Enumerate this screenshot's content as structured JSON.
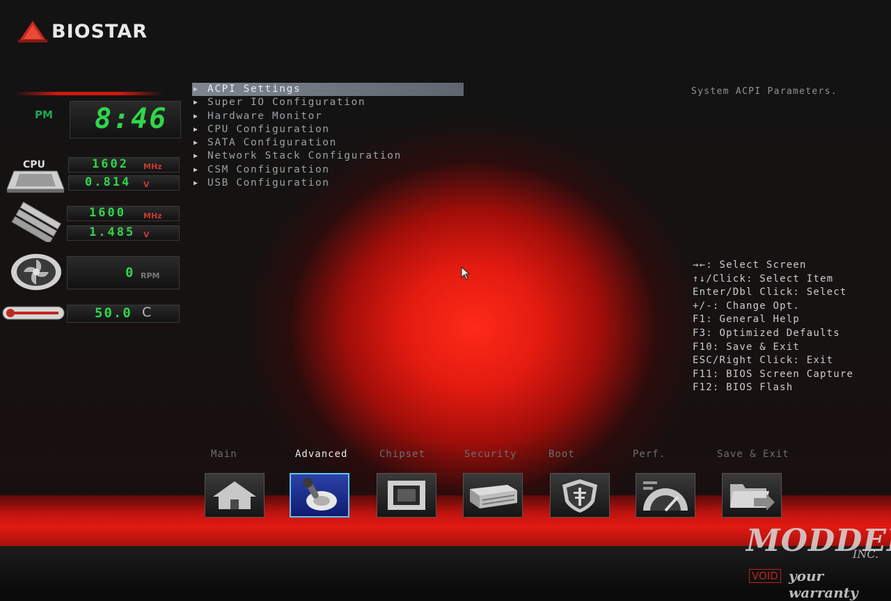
{
  "brand": {
    "logo_text": "BIOSTAR"
  },
  "monitor": {
    "clock": {
      "period": "PM",
      "time": "8:46"
    },
    "cpu": {
      "label": "CPU",
      "freq": "1602",
      "freq_unit": "MHz",
      "voltage": "0.814",
      "voltage_unit": "V"
    },
    "memory": {
      "freq": "1600",
      "freq_unit": "MHz",
      "voltage": "1.485",
      "voltage_unit": "V"
    },
    "fan": {
      "rpm": "0",
      "rpm_unit": "RPM"
    },
    "temp": {
      "value": "50.0",
      "unit": "C"
    }
  },
  "menu": {
    "items": [
      {
        "label": "ACPI Settings",
        "selected": true
      },
      {
        "label": "Super IO Configuration"
      },
      {
        "label": "Hardware Monitor"
      },
      {
        "label": "CPU Configuration"
      },
      {
        "label": "SATA Configuration"
      },
      {
        "label": "Network Stack Configuration"
      },
      {
        "label": "CSM Configuration"
      },
      {
        "label": "USB Configuration"
      }
    ]
  },
  "help": {
    "description": "System ACPI Parameters.",
    "keys": [
      "→←: Select Screen",
      "↑↓/Click: Select Item",
      "Enter/Dbl Click: Select",
      "+/-: Change Opt.",
      "F1: General Help",
      "F3: Optimized Defaults",
      "F10: Save & Exit",
      "ESC/Right Click: Exit",
      "F11: BIOS Screen Capture",
      "F12: BIOS Flash"
    ]
  },
  "tabs": [
    {
      "label": "Main",
      "icon": "home-icon"
    },
    {
      "label": "Advanced",
      "icon": "joystick-icon",
      "active": true
    },
    {
      "label": "Chipset",
      "icon": "chip-icon"
    },
    {
      "label": "Security",
      "icon": "server-icon"
    },
    {
      "label": "Boot",
      "icon": "shield-icon"
    },
    {
      "label": "Perf.",
      "icon": "speedometer-icon"
    },
    {
      "label": "Save & Exit",
      "icon": "folder-exit-icon"
    }
  ],
  "watermark": {
    "line1": "MODDERS",
    "line2": "INC.",
    "void": "VOID",
    "line3": "your warranty"
  },
  "colors": {
    "accent_red": "#e21a12",
    "led_green": "#2fd64a",
    "selected_tab_blue": "#2c42a8"
  }
}
